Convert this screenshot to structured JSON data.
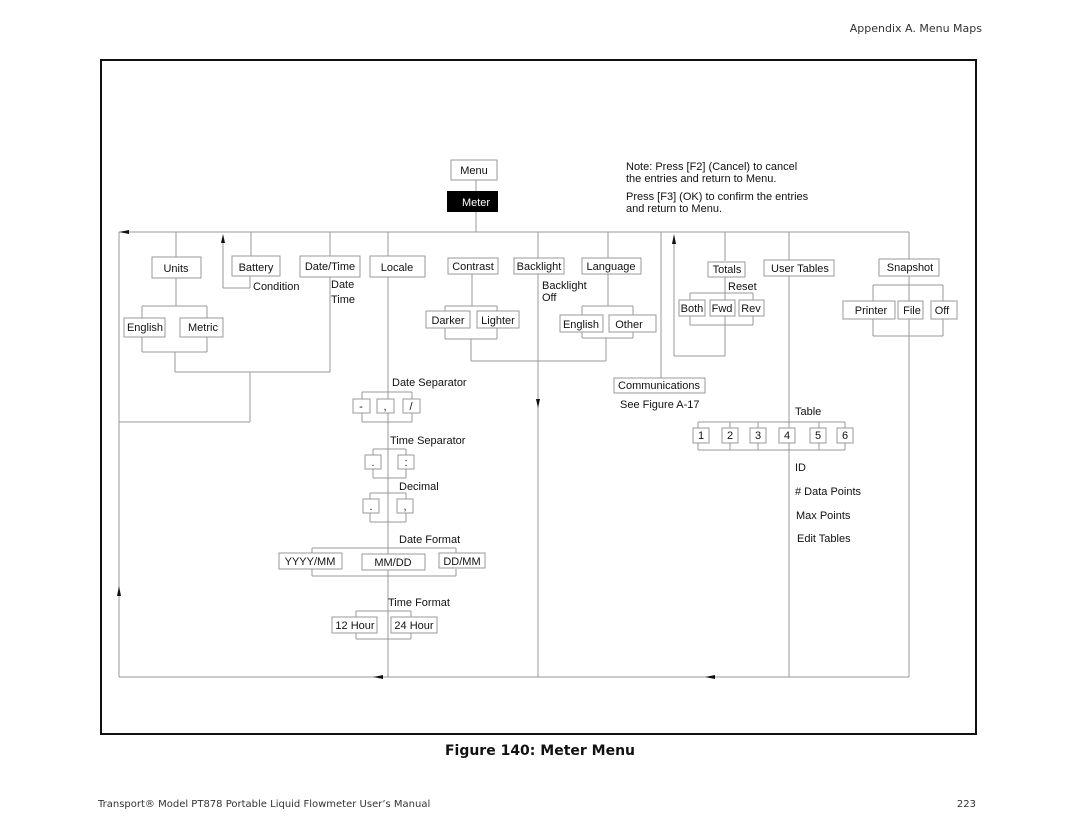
{
  "page": {
    "header": "Appendix A. Menu Maps",
    "caption": "Figure 140:  Meter Menu",
    "footer": "Transport® Model PT878 Portable Liquid Flowmeter User’s Manual",
    "page_number": "223"
  },
  "diagram": {
    "root": "Menu",
    "selected": "Meter",
    "notes": [
      "Note: Press [F2] (Cancel) to cancel",
      "the entries and return to Menu.",
      "Press [F3] (OK) to confirm the entries",
      "and return to Menu."
    ],
    "units": {
      "label": "Units",
      "options": [
        "English",
        "Metric"
      ]
    },
    "battery": {
      "label": "Battery",
      "sub": "Condition"
    },
    "datetime": {
      "label": "Date/Time",
      "sub": [
        "Date",
        "Time"
      ]
    },
    "locale": {
      "label": "Locale",
      "date_separator": {
        "label": "Date Separator",
        "options": [
          "-",
          ",",
          "/"
        ]
      },
      "time_separator": {
        "label": "Time Separator",
        "options": [
          ".",
          ":"
        ]
      },
      "decimal": {
        "label": "Decimal",
        "options": [
          ".",
          ","
        ]
      },
      "date_format": {
        "label": "Date Format",
        "options": [
          "YYYY/MM",
          "MM/DD",
          "DD/MM"
        ]
      },
      "time_format": {
        "label": "Time Format",
        "options": [
          "12 Hour",
          "24 Hour"
        ]
      }
    },
    "contrast": {
      "label": "Contrast",
      "options": [
        "Darker",
        "Lighter"
      ]
    },
    "backlight": {
      "label": "Backlight",
      "sub": [
        "Backlight",
        "Off"
      ]
    },
    "language": {
      "label": "Language",
      "options": [
        "English",
        "Other"
      ]
    },
    "communications": {
      "label": "Communications",
      "sub": "See Figure A-17"
    },
    "totals": {
      "label": "Totals",
      "sub": "Reset",
      "options": [
        "Both",
        "Fwd",
        "Rev"
      ]
    },
    "user_tables": {
      "label": "User Tables",
      "table_label": "Table",
      "tables": [
        "1",
        "2",
        "3",
        "4",
        "5",
        "6"
      ],
      "fields": [
        "ID",
        "# Data Points",
        "Max Points",
        "Edit Tables"
      ]
    },
    "snapshot": {
      "label": "Snapshot",
      "options": [
        "Printer",
        "File",
        "Off"
      ]
    }
  }
}
